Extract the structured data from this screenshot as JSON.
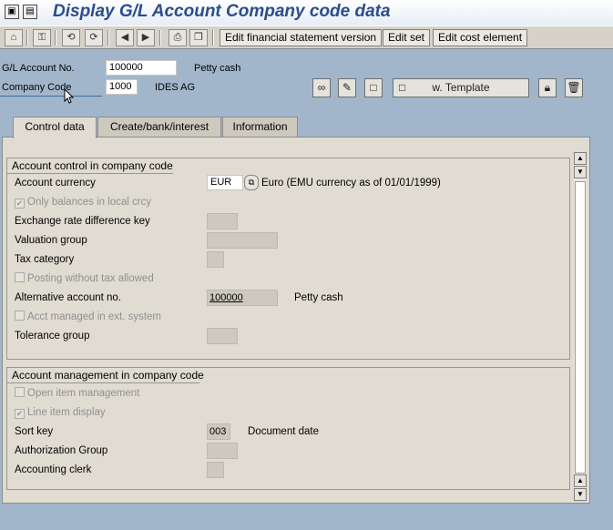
{
  "window": {
    "title": "Display G/L Account Company code data",
    "app_icons": [
      "sap-menu-icon",
      "page-icon"
    ]
  },
  "toolbar": {
    "icons": [
      "other-object-icon",
      "display-change-icon",
      "switch-icon",
      "refresh-icon",
      "previous-icon",
      "next-icon",
      "print-icon",
      "copy-icon"
    ],
    "buttons": [
      "Edit financial statement version",
      "Edit set",
      "Edit cost element"
    ]
  },
  "header": {
    "gl_account": {
      "label": "G/L Account No.",
      "value": "100000",
      "desc": "Petty cash"
    },
    "company_code": {
      "label": "Company Code",
      "value": "1000",
      "desc": "IDES AG"
    },
    "buttons": [
      "glasses-icon",
      "pencil-icon",
      "create-icon"
    ],
    "template_button": "w. Template",
    "lock_icon": "lock-icon",
    "delete_icon": "trash-icon"
  },
  "tabs": [
    {
      "label": "Control data",
      "active": true
    },
    {
      "label": "Create/bank/interest",
      "active": false
    },
    {
      "label": "Information",
      "active": false
    }
  ],
  "account_control": {
    "title": "Account control in company code",
    "currency": {
      "label": "Account currency",
      "value": "EUR",
      "desc": "Euro (EMU currency as of 01/01/1999)"
    },
    "only_local": {
      "label": "Only balances in local crcy",
      "checked": true
    },
    "exchange_key": {
      "label": "Exchange rate difference key",
      "value": ""
    },
    "valuation_group": {
      "label": "Valuation group",
      "value": ""
    },
    "tax_category": {
      "label": "Tax category",
      "value": ""
    },
    "posting_without_tax": {
      "label": "Posting without tax allowed",
      "checked": false
    },
    "alt_account": {
      "label": "Alternative account no.",
      "value": "100000",
      "desc": "Petty cash"
    },
    "acct_managed_ext": {
      "label": "Acct managed in ext. system",
      "checked": false
    },
    "tolerance_group": {
      "label": "Tolerance group",
      "value": ""
    }
  },
  "account_management": {
    "title": "Account management in company code",
    "open_item": {
      "label": "Open item management",
      "checked": false
    },
    "line_item": {
      "label": "Line item display",
      "checked": true
    },
    "sort_key": {
      "label": "Sort key",
      "value": "003",
      "desc": "Document date"
    },
    "auth_group": {
      "label": "Authorization Group",
      "value": ""
    },
    "accounting_clerk": {
      "label": "Accounting clerk",
      "value": ""
    }
  },
  "symbols": {
    "check": "✔",
    "up": "▲",
    "down": "▼",
    "prev": "◀",
    "next": "▶",
    "f4": "⧉"
  },
  "colors": {
    "title": "#2b4d8c",
    "background": "#a1b6cb",
    "panel": "#e0dcd2"
  }
}
